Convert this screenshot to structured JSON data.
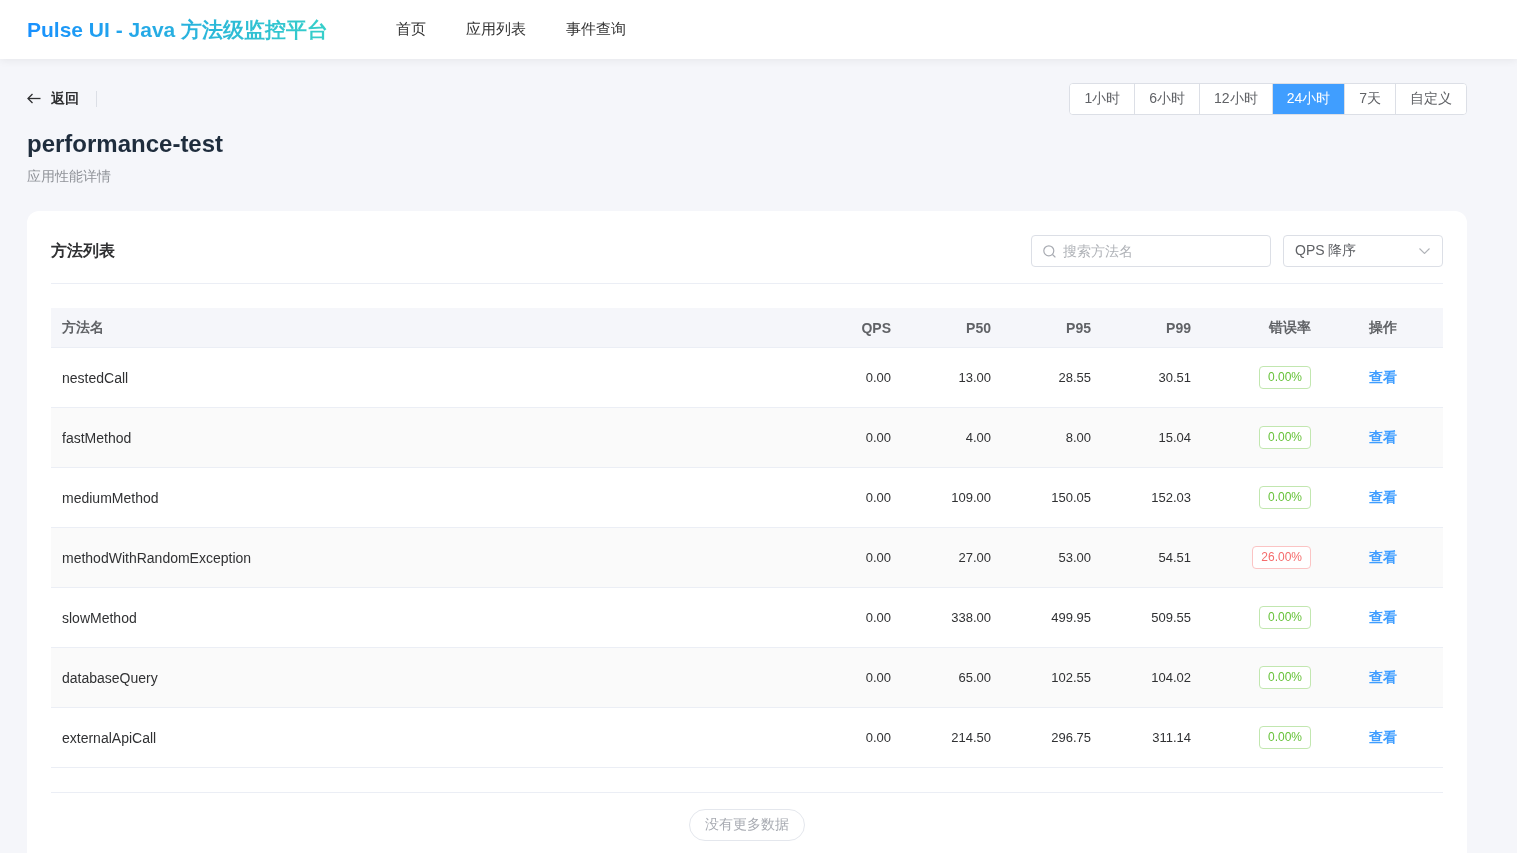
{
  "header": {
    "logo": "Pulse UI - Java 方法级监控平台",
    "nav": [
      {
        "label": "首页"
      },
      {
        "label": "应用列表"
      },
      {
        "label": "事件查询"
      }
    ]
  },
  "back": {
    "label": "返回"
  },
  "time_range": [
    {
      "label": "1小时",
      "selected": false
    },
    {
      "label": "6小时",
      "selected": false
    },
    {
      "label": "12小时",
      "selected": false
    },
    {
      "label": "24小时",
      "selected": true
    },
    {
      "label": "7天",
      "selected": false
    },
    {
      "label": "自定义",
      "selected": false
    }
  ],
  "page": {
    "title": "performance-test",
    "subtitle": "应用性能详情"
  },
  "methods": {
    "title": "方法列表",
    "search": {
      "placeholder": "搜索方法名"
    },
    "sort": {
      "value": "QPS 降序"
    },
    "table": {
      "columns": [
        "方法名",
        "QPS",
        "P50",
        "P95",
        "P99",
        "错误率",
        "操作"
      ],
      "rows": [
        {
          "name": "nestedCall",
          "qps": "0.00",
          "p50": "13.00",
          "p95": "28.55",
          "p99": "30.51",
          "error_rate": "0.00%",
          "error_high": false,
          "action": "查看"
        },
        {
          "name": "fastMethod",
          "qps": "0.00",
          "p50": "4.00",
          "p95": "8.00",
          "p99": "15.04",
          "error_rate": "0.00%",
          "error_high": false,
          "action": "查看"
        },
        {
          "name": "mediumMethod",
          "qps": "0.00",
          "p50": "109.00",
          "p95": "150.05",
          "p99": "152.03",
          "error_rate": "0.00%",
          "error_high": false,
          "action": "查看"
        },
        {
          "name": "methodWithRandomException",
          "qps": "0.00",
          "p50": "27.00",
          "p95": "53.00",
          "p99": "54.51",
          "error_rate": "26.00%",
          "error_high": true,
          "action": "查看"
        },
        {
          "name": "slowMethod",
          "qps": "0.00",
          "p50": "338.00",
          "p95": "499.95",
          "p99": "509.55",
          "error_rate": "0.00%",
          "error_high": false,
          "action": "查看"
        },
        {
          "name": "databaseQuery",
          "qps": "0.00",
          "p50": "65.00",
          "p95": "102.55",
          "p99": "104.02",
          "error_rate": "0.00%",
          "error_high": false,
          "action": "查看"
        },
        {
          "name": "externalApiCall",
          "qps": "0.00",
          "p50": "214.50",
          "p95": "296.75",
          "p99": "311.14",
          "error_rate": "0.00%",
          "error_high": false,
          "action": "查看"
        }
      ]
    },
    "footer": "没有更多数据"
  }
}
